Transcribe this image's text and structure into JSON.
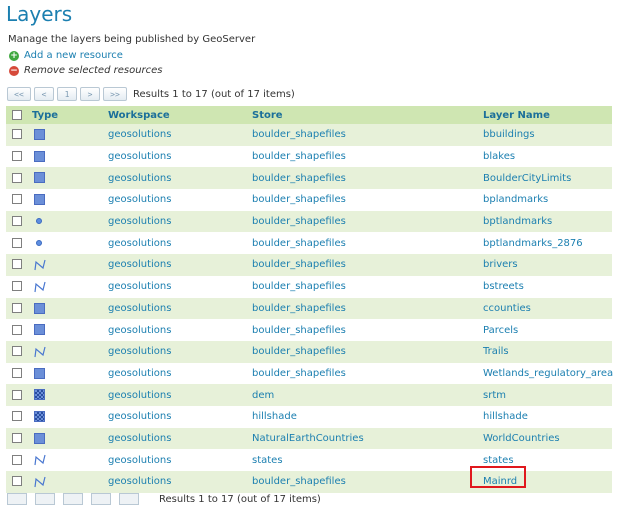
{
  "page": {
    "title": "Layers",
    "description": "Manage the layers being published by GeoServer"
  },
  "actions": {
    "add_label": "Add a new resource",
    "remove_label": "Remove selected resources"
  },
  "pager": {
    "first": "<<",
    "prev": "<",
    "current": "1",
    "next": ">",
    "last": ">>",
    "results": "Results 1 to 17 (out of 17 items)"
  },
  "table": {
    "headers": {
      "type": "Type",
      "workspace": "Workspace",
      "store": "Store",
      "layer": "Layer Name"
    },
    "rows": [
      {
        "type": "polygon",
        "workspace": "geosolutions",
        "store": "boulder_shapefiles",
        "layer": "bbuildings"
      },
      {
        "type": "polygon",
        "workspace": "geosolutions",
        "store": "boulder_shapefiles",
        "layer": "blakes"
      },
      {
        "type": "polygon",
        "workspace": "geosolutions",
        "store": "boulder_shapefiles",
        "layer": "BoulderCityLimits"
      },
      {
        "type": "polygon",
        "workspace": "geosolutions",
        "store": "boulder_shapefiles",
        "layer": "bplandmarks"
      },
      {
        "type": "point",
        "workspace": "geosolutions",
        "store": "boulder_shapefiles",
        "layer": "bptlandmarks"
      },
      {
        "type": "point",
        "workspace": "geosolutions",
        "store": "boulder_shapefiles",
        "layer": "bptlandmarks_2876"
      },
      {
        "type": "line",
        "workspace": "geosolutions",
        "store": "boulder_shapefiles",
        "layer": "brivers"
      },
      {
        "type": "line",
        "workspace": "geosolutions",
        "store": "boulder_shapefiles",
        "layer": "bstreets"
      },
      {
        "type": "polygon",
        "workspace": "geosolutions",
        "store": "boulder_shapefiles",
        "layer": "ccounties"
      },
      {
        "type": "polygon",
        "workspace": "geosolutions",
        "store": "boulder_shapefiles",
        "layer": "Parcels"
      },
      {
        "type": "line",
        "workspace": "geosolutions",
        "store": "boulder_shapefiles",
        "layer": "Trails"
      },
      {
        "type": "polygon",
        "workspace": "geosolutions",
        "store": "boulder_shapefiles",
        "layer": "Wetlands_regulatory_area"
      },
      {
        "type": "raster",
        "workspace": "geosolutions",
        "store": "dem",
        "layer": "srtm"
      },
      {
        "type": "raster",
        "workspace": "geosolutions",
        "store": "hillshade",
        "layer": "hillshade"
      },
      {
        "type": "polygon",
        "workspace": "geosolutions",
        "store": "NaturalEarthCountries",
        "layer": "WorldCountries"
      },
      {
        "type": "line",
        "workspace": "geosolutions",
        "store": "states",
        "layer": "states"
      },
      {
        "type": "line",
        "workspace": "geosolutions",
        "store": "boulder_shapefiles",
        "layer": "Mainrd",
        "highlighted": true
      }
    ]
  },
  "bottom_pager": {
    "results": "Results 1 to 17 (out of 17 items)"
  },
  "colors": {
    "title": "#1b7fb0",
    "link": "#1b7fb0",
    "header_bg": "#cfe6b2",
    "row_alt_bg": "#e7f1d9",
    "highlight_box": "#e0181d"
  }
}
